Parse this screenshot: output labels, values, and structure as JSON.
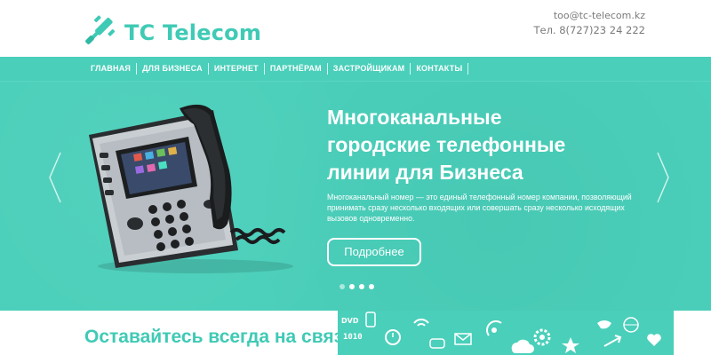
{
  "brand": {
    "name": "TC Telecom",
    "logo_icon": "plug-icon",
    "accent_color": "#3fcab5",
    "teal_bg": "#4acfba"
  },
  "contacts": {
    "email": "too@tc-telecom.kz",
    "phone": "Тел. 8(727)23 24 222"
  },
  "nav": {
    "items": [
      {
        "label": "ГЛАВНАЯ"
      },
      {
        "label": "ДЛЯ БИЗНЕСА"
      },
      {
        "label": "ИНТЕРНЕТ"
      },
      {
        "label": "ПАРТНЁРАМ"
      },
      {
        "label": "ЗАСТРОЙЩИКАМ"
      },
      {
        "label": "КОНТАКТЫ"
      }
    ]
  },
  "hero": {
    "title_line1": "Многоканальные",
    "title_line2": "городские телефонные",
    "title_line3": "линии для Бизнеса",
    "desc_line1": "Многоканальный номер — это единый телефонный номер компании, позволяющий",
    "desc_line2": "принимать сразу несколько входящих или совершать сразу несколько исходящих",
    "desc_line3": "вызовов одновременно.",
    "button_label": "Подробнее",
    "slide_count": 4,
    "active_slide_indexes": [
      1,
      2,
      3
    ],
    "left_arrow_icon": "chevron-left-icon",
    "right_arrow_icon": "chevron-right-icon",
    "image_icon": "desk-phone-icon"
  },
  "bottom": {
    "title": "Оставайтесь всегда на связи",
    "icons": [
      "dvd-icon",
      "phone-icon",
      "alarm-icon",
      "binary-icon",
      "chat-icon",
      "mail-icon",
      "satellite-icon",
      "bird-icon",
      "wifi-icon",
      "gear-icon"
    ],
    "binary_text": "1010"
  }
}
